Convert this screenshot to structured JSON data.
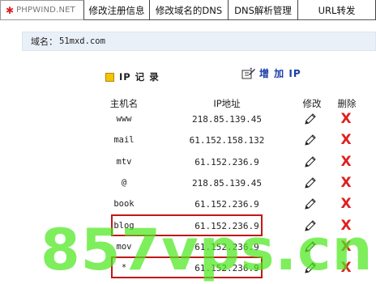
{
  "tabs": {
    "brand": "PHPWIND.NET",
    "register_info": "修改注册信息",
    "dns_name": "修改域名的DNS",
    "dns_manage": "DNS解析管理",
    "url_forward": "URL转发"
  },
  "domain": {
    "label": "域名：",
    "value": "51mxd.com"
  },
  "records": {
    "title": "IP 记 录",
    "add_label": "增 加 IP",
    "headers": {
      "host": "主机名",
      "ip": "IP地址",
      "edit": "修改",
      "delete": "删除"
    },
    "rows": [
      {
        "host": "www",
        "ip": "218.85.139.45"
      },
      {
        "host": "mail",
        "ip": "61.152.158.132"
      },
      {
        "host": "mtv",
        "ip": "61.152.236.9"
      },
      {
        "host": "@",
        "ip": "218.85.139.45"
      },
      {
        "host": "book",
        "ip": "61.152.236.9"
      },
      {
        "host": "blog",
        "ip": "61.152.236.9"
      },
      {
        "host": "mov",
        "ip": "61.152.236.9"
      },
      {
        "host": "*",
        "ip": "61.152.236.9"
      }
    ],
    "highlighted_rows": [
      "blog",
      "*"
    ],
    "delete_glyph": "X"
  },
  "watermark": "857vps.cn",
  "colors": {
    "accent_blue": "#1a3fa8",
    "delete_red": "#e02020",
    "highlight_red": "#c01818",
    "domain_bar_bg": "#e9f0f8",
    "title_square": "#f5c400",
    "watermark_green": "#4ce81e"
  },
  "icons": {
    "brand": "star-logo-icon",
    "title": "yellow-square-icon",
    "add": "add-record-icon",
    "edit": "pencil-icon",
    "delete": "red-x-icon"
  }
}
